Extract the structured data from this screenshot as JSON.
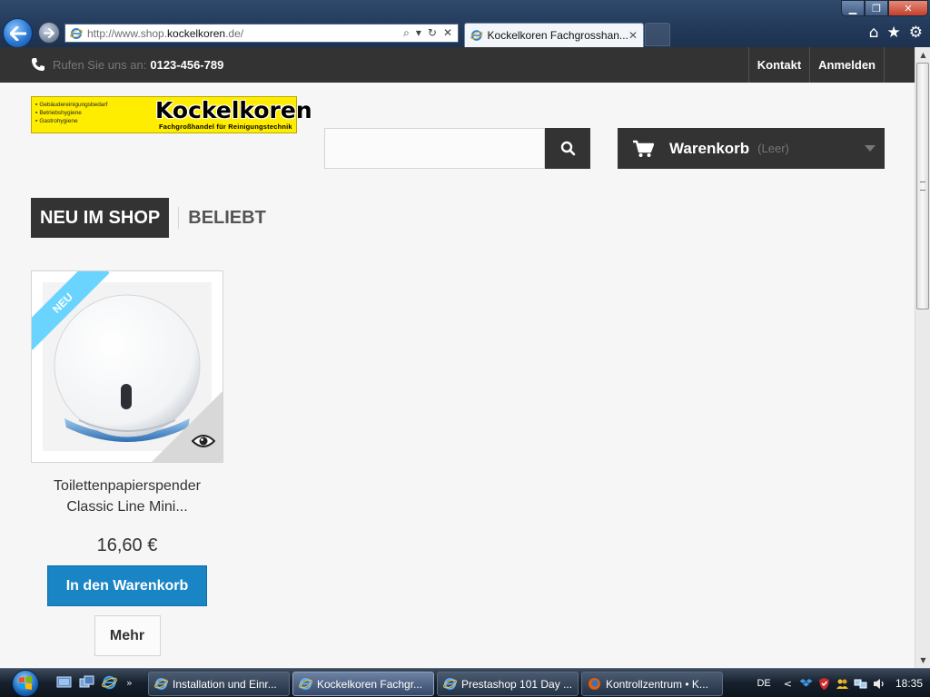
{
  "browser": {
    "address": {
      "url_prefix": "http://www.shop.",
      "url_domain": "kockelkoren",
      "url_suffix": ".de/"
    },
    "tab": {
      "title": "Kockelkoren Fachgrosshan...",
      "close": "✕"
    },
    "window_controls": {
      "minimize": "▁",
      "maximize": "❐",
      "close": "✕"
    },
    "address_tools": {
      "search": "⌕",
      "dropdown": "▾",
      "refresh": "↻",
      "stop": "✕"
    },
    "toolbar_icons": {
      "home": "⌂",
      "favorites": "★",
      "tools": "⚙"
    }
  },
  "page": {
    "topbar": {
      "phone_label": "Rufen Sie uns an:",
      "phone_number": "0123-456-789",
      "links": [
        "Kontakt",
        "Anmelden"
      ]
    },
    "logo": {
      "lines": [
        "Gebäudereinigungsbedarf",
        "Betriebshygiene",
        "Gastrohygiene"
      ],
      "brand": "Kockelkoren",
      "tagline": "Fachgroßhandel für Reinigungstechnik"
    },
    "search": {
      "placeholder": "",
      "value": ""
    },
    "cart": {
      "title": "Warenkorb",
      "status": "(Leer)"
    },
    "tabs": {
      "active": "NEU IM SHOP",
      "inactive": "BELIEBT"
    },
    "product": {
      "badge": "NEU",
      "name_line1": "Toilettenpapierspender",
      "name_line2": "Classic Line Mini...",
      "price": "16,60 €",
      "add_to_cart": "In den Warenkorb",
      "more": "Mehr"
    }
  },
  "taskbar": {
    "tasks": [
      {
        "label": "Installation und Einr...",
        "active": false
      },
      {
        "label": "Kockelkoren Fachgr...",
        "active": true
      },
      {
        "label": "Prestashop 101 Day ...",
        "active": false
      },
      {
        "label": "Kontrollzentrum • K...",
        "active": false
      }
    ],
    "quicklaunch_more": "»",
    "tray": {
      "lang": "DE",
      "arrow": "<",
      "time": "18:35"
    }
  },
  "colors": {
    "accent_blue": "#1a85c5",
    "dark_bar": "#333333",
    "logo_yellow": "#ffed00",
    "badge_blue": "#6ad4ff"
  }
}
